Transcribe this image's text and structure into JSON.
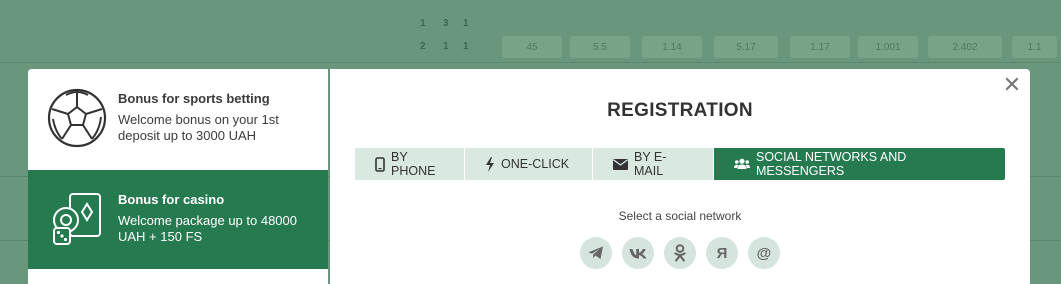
{
  "background": {
    "cells": [
      "1",
      "3",
      "1",
      "2",
      "1",
      "1",
      "45",
      "5.5",
      "1.14",
      "5.17",
      "1.17",
      "1.001",
      "2.402",
      "1.1"
    ]
  },
  "bonuses": [
    {
      "title": "Bonus for sports betting",
      "description": "Welcome bonus on your 1st deposit up to 3000 UAH",
      "icon": "soccer-ball-icon"
    },
    {
      "title": "Bonus for casino",
      "description": "Welcome package up to 48000 UAH + 150 FS",
      "icon": "casino-chips-dice-icon"
    }
  ],
  "modal": {
    "title": "REGISTRATION",
    "close_label": "✕",
    "tabs": [
      {
        "label": "BY PHONE",
        "icon": "phone-icon"
      },
      {
        "label": "ONE-CLICK",
        "icon": "lightning-icon"
      },
      {
        "label": "BY E-MAIL",
        "icon": "envelope-icon"
      },
      {
        "label": "SOCIAL NETWORKS AND MESSENGERS",
        "icon": "users-icon"
      }
    ],
    "active_tab": 3,
    "social_caption": "Select a social network",
    "social_networks": [
      {
        "name": "telegram",
        "glyph": ""
      },
      {
        "name": "vk",
        "glyph": ""
      },
      {
        "name": "odnoklassniki",
        "glyph": ""
      },
      {
        "name": "yandex",
        "glyph": "Я"
      },
      {
        "name": "mail-ru",
        "glyph": "@"
      }
    ]
  },
  "colors": {
    "accent": "#267a50",
    "tab_inactive": "#d9e9e0",
    "social_bg": "#d5e4dc"
  }
}
